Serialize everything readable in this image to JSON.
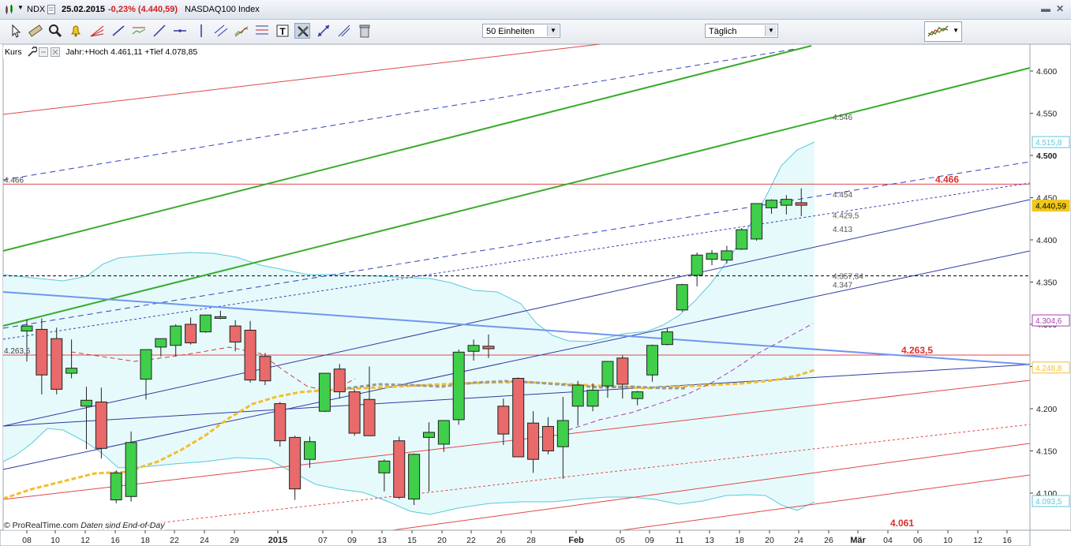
{
  "header": {
    "symbol": "NDX",
    "date": "25.02.2015",
    "change": "-0,23% (4.440,59)",
    "name": "NASDAQ100 Index"
  },
  "toolbar": {
    "units_select": "50 Einheiten",
    "period_select": "Täglich"
  },
  "legend": {
    "label": "Kurs",
    "text": "Jahr:+Hoch 4.461,11 +Tief 4.078,85"
  },
  "footer": {
    "copyright": "© ProRealTime.com",
    "note": "Daten sind End-of-Day"
  },
  "colors": {
    "up": "#3fcf4a",
    "down": "#e86a6a",
    "band": "#5bc8dc",
    "band_fill": "#e6fafb",
    "blue_line": "#2f3aa3",
    "green_line": "#3aab2e",
    "red_line": "#e04848",
    "ma_orange": "#f5bd2a",
    "ma_red": "#d43a3a",
    "ma_purple": "#a83fb0",
    "trend_lightblue": "#6f96f0",
    "price_tag": "#f0c81c"
  },
  "chart_data": {
    "type": "candlestick",
    "symbol": "NDX",
    "ylim": [
      4078,
      4640
    ],
    "y_ticks": [
      4100,
      4150,
      4200,
      4250,
      4300,
      4350,
      4400,
      4450,
      4500,
      4550,
      4600
    ],
    "y_tick_labels": [
      "4.100",
      "4.150",
      "4.200",
      "4.250",
      "4.300",
      "4.350",
      "4.400",
      "4.450",
      "4.500",
      "4.550",
      "4.600"
    ],
    "x_tick_labels": [
      "08",
      "10",
      "12",
      "16",
      "18",
      "22",
      "24",
      "29",
      "2015",
      "07",
      "09",
      "13",
      "15",
      "20",
      "22",
      "26",
      "28",
      "Feb",
      "05",
      "09",
      "11",
      "13",
      "18",
      "20",
      "24",
      "26",
      "Mär",
      "04",
      "06",
      "10",
      "12",
      "16"
    ],
    "candles": [
      {
        "o": 4292,
        "h": 4306,
        "l": 4256,
        "c": 4298
      },
      {
        "o": 4294,
        "h": 4307,
        "l": 4217,
        "c": 4240
      },
      {
        "o": 4283,
        "h": 4296,
        "l": 4217,
        "c": 4223
      },
      {
        "o": 4242,
        "h": 4282,
        "l": 4236,
        "c": 4248
      },
      {
        "o": 4203,
        "h": 4226,
        "l": 4152,
        "c": 4210
      },
      {
        "o": 4208,
        "h": 4225,
        "l": 4141,
        "c": 4153
      },
      {
        "o": 4092,
        "h": 4127,
        "l": 4088,
        "c": 4124
      },
      {
        "o": 4096,
        "h": 4173,
        "l": 4090,
        "c": 4160
      },
      {
        "o": 4235,
        "h": 4267,
        "l": 4211,
        "c": 4270
      },
      {
        "o": 4273,
        "h": 4283,
        "l": 4262,
        "c": 4283
      },
      {
        "o": 4275,
        "h": 4300,
        "l": 4262,
        "c": 4298
      },
      {
        "o": 4300,
        "h": 4308,
        "l": 4276,
        "c": 4278
      },
      {
        "o": 4291,
        "h": 4302,
        "l": 4290,
        "c": 4311
      },
      {
        "o": 4307,
        "h": 4316,
        "l": 4306,
        "c": 4309
      },
      {
        "o": 4298,
        "h": 4305,
        "l": 4268,
        "c": 4279
      },
      {
        "o": 4293,
        "h": 4304,
        "l": 4231,
        "c": 4234
      },
      {
        "o": 4262,
        "h": 4266,
        "l": 4228,
        "c": 4233
      },
      {
        "o": 4206,
        "h": 4208,
        "l": 4155,
        "c": 4162
      },
      {
        "o": 4166,
        "h": 4168,
        "l": 4092,
        "c": 4105
      },
      {
        "o": 4140,
        "h": 4167,
        "l": 4130,
        "c": 4161
      },
      {
        "o": 4197,
        "h": 4238,
        "l": 4196,
        "c": 4242
      },
      {
        "o": 4247,
        "h": 4253,
        "l": 4212,
        "c": 4220
      },
      {
        "o": 4220,
        "h": 4223,
        "l": 4168,
        "c": 4171
      },
      {
        "o": 4211,
        "h": 4250,
        "l": 4168,
        "c": 4168
      },
      {
        "o": 4124,
        "h": 4140,
        "l": 4102,
        "c": 4138
      },
      {
        "o": 4162,
        "h": 4167,
        "l": 4093,
        "c": 4095
      },
      {
        "o": 4093,
        "h": 4147,
        "l": 4086,
        "c": 4146
      },
      {
        "o": 4166,
        "h": 4184,
        "l": 4102,
        "c": 4172
      },
      {
        "o": 4158,
        "h": 4182,
        "l": 4149,
        "c": 4186
      },
      {
        "o": 4187,
        "h": 4270,
        "l": 4181,
        "c": 4267
      },
      {
        "o": 4268,
        "h": 4282,
        "l": 4257,
        "c": 4275
      },
      {
        "o": 4274,
        "h": 4288,
        "l": 4260,
        "c": 4271
      },
      {
        "o": 4203,
        "h": 4212,
        "l": 4157,
        "c": 4170
      },
      {
        "o": 4236,
        "h": 4237,
        "l": 4143,
        "c": 4143
      },
      {
        "o": 4183,
        "h": 4197,
        "l": 4124,
        "c": 4140
      },
      {
        "o": 4179,
        "h": 4190,
        "l": 4146,
        "c": 4150
      },
      {
        "o": 4155,
        "h": 4214,
        "l": 4117,
        "c": 4186
      },
      {
        "o": 4203,
        "h": 4233,
        "l": 4180,
        "c": 4228
      },
      {
        "o": 4203,
        "h": 4230,
        "l": 4197,
        "c": 4222
      },
      {
        "o": 4227,
        "h": 4255,
        "l": 4213,
        "c": 4256
      },
      {
        "o": 4260,
        "h": 4263,
        "l": 4212,
        "c": 4229
      },
      {
        "o": 4212,
        "h": 4221,
        "l": 4204,
        "c": 4220
      },
      {
        "o": 4240,
        "h": 4276,
        "l": 4232,
        "c": 4275
      },
      {
        "o": 4276,
        "h": 4295,
        "l": 4275,
        "c": 4291
      },
      {
        "o": 4317,
        "h": 4348,
        "l": 4315,
        "c": 4347
      },
      {
        "o": 4358,
        "h": 4385,
        "l": 4345,
        "c": 4382
      },
      {
        "o": 4377,
        "h": 4388,
        "l": 4370,
        "c": 4384
      },
      {
        "o": 4376,
        "h": 4393,
        "l": 4372,
        "c": 4387
      },
      {
        "o": 4389,
        "h": 4414,
        "l": 4388,
        "c": 4412
      },
      {
        "o": 4401,
        "h": 4442,
        "l": 4399,
        "c": 4443
      },
      {
        "o": 4438,
        "h": 4448,
        "l": 4431,
        "c": 4447
      },
      {
        "o": 4441,
        "h": 4453,
        "l": 4430,
        "c": 4448
      },
      {
        "o": 4444,
        "h": 4461,
        "l": 4428,
        "c": 4441
      }
    ],
    "annotations": {
      "right_labels": [
        {
          "text": "4.546",
          "value": 4546
        },
        {
          "text": "4.454",
          "value": 4454
        },
        {
          "text": "4.429,5",
          "value": 4429.5
        },
        {
          "text": "4.413",
          "value": 4413
        },
        {
          "text": "4.357,34",
          "value": 4357.34
        },
        {
          "text": "4.347",
          "value": 4347
        }
      ],
      "red_labels": [
        {
          "text": "4.466",
          "value": 4466
        },
        {
          "text": "4.263,5",
          "value": 4263.5
        },
        {
          "text": "4.061",
          "value": 4061
        }
      ],
      "left_labels": [
        {
          "text": "4.466",
          "value": 4466
        },
        {
          "text": "4.263,5",
          "value": 4263.5
        }
      ],
      "axis_tags": [
        {
          "text": "4.515,8",
          "value": 4515.8,
          "color": "#5bc8dc"
        },
        {
          "text": "4.440,59",
          "value": 4440.59,
          "color": "#f0c81c"
        },
        {
          "text": "4.304,6",
          "value": 4304.6,
          "color": "#a83fb0"
        },
        {
          "text": "4.248,8",
          "value": 4248.8,
          "color": "#f5bd2a"
        },
        {
          "text": "4.093,5",
          "value": 4093.5,
          "color": "#5bc8dc"
        }
      ],
      "horizontal_lines": [
        {
          "value": 4466,
          "color": "#e04848",
          "style": "solid"
        },
        {
          "value": 4263.5,
          "color": "#e04848",
          "style": "solid"
        },
        {
          "value": 4357.34,
          "color": "#000000",
          "style": "dashed"
        }
      ]
    }
  }
}
